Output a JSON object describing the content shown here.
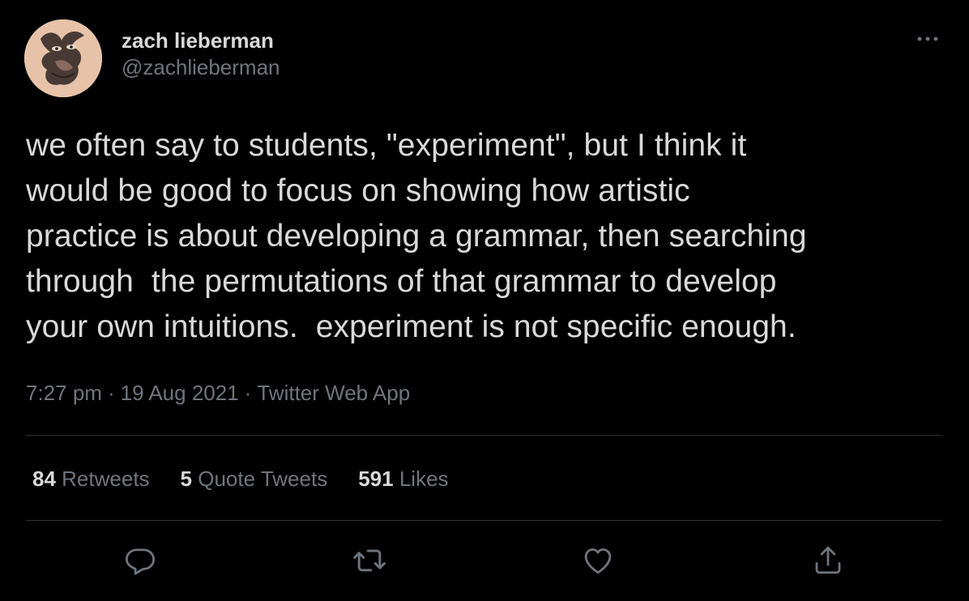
{
  "author": {
    "name": "zach lieberman",
    "handle": "@zachlieberman"
  },
  "tweet": {
    "text": "we often say to students, \"experiment\", but I think it\nwould be good to focus on showing how artistic\npractice is about developing a grammar, then searching\nthrough  the permutations of that grammar to develop\nyour own intuitions.  experiment is not specific enough.",
    "time": "7:27 pm",
    "date": "19 Aug 2021",
    "source": "Twitter Web App",
    "separator": "·"
  },
  "stats": {
    "retweets_count": "84",
    "retweets_label": "Retweets",
    "quotes_count": "5",
    "quotes_label": "Quote Tweets",
    "likes_count": "591",
    "likes_label": "Likes"
  },
  "icons": {
    "more": "more-horizontal-icon",
    "reply": "reply-icon",
    "retweet": "retweet-icon",
    "like": "heart-icon",
    "share": "share-icon"
  },
  "colors": {
    "background": "#000000",
    "text": "#d9d9d9",
    "muted": "#6e767d",
    "divider": "#2f3336"
  }
}
